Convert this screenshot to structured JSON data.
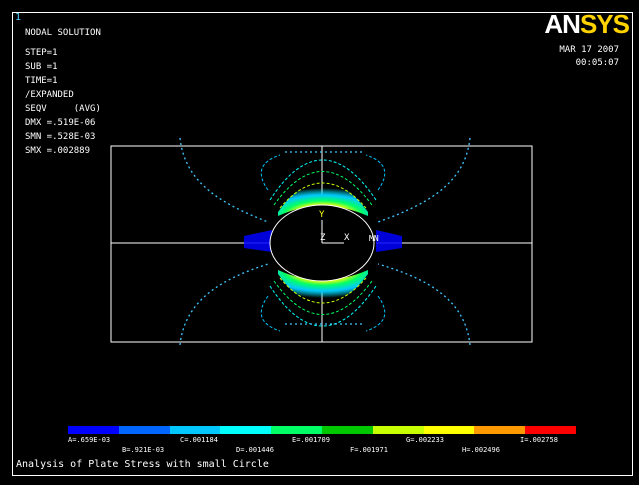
{
  "window": {
    "number": "1"
  },
  "logo": {
    "part1": "AN",
    "part2": "SYS"
  },
  "info": {
    "line1": "NODAL SOLUTION",
    "line2": "STEP=1",
    "line3": "SUB =1",
    "line4": "TIME=1",
    "line5": "/EXPANDED",
    "line6": "SEQV     (AVG)",
    "line7": "DMX =.519E-06",
    "line8": "SMN =.528E-03",
    "line9": "SMX =.002889"
  },
  "date": {
    "day": "MAR 17 2007",
    "time": "00:05:07"
  },
  "triad": {
    "y": "Y",
    "z": "Z",
    "x": "X",
    "mn": "MN"
  },
  "legend": {
    "colors": [
      "#0000ff",
      "#0066ff",
      "#00c8ff",
      "#00ffff",
      "#00ff66",
      "#00c800",
      "#c8ff00",
      "#ffff00",
      "#ff9900",
      "#ff0000"
    ],
    "labels": {
      "a": "A=.659E-03",
      "b": "B=.921E-03",
      "c": "C=.001184",
      "d": "D=.001446",
      "e": "E=.001709",
      "f": "F=.001971",
      "g": "G=.002233",
      "h": "H=.002496",
      "i": "I=.002758"
    }
  },
  "title": "Analysis of Plate Stress with small Circle"
}
